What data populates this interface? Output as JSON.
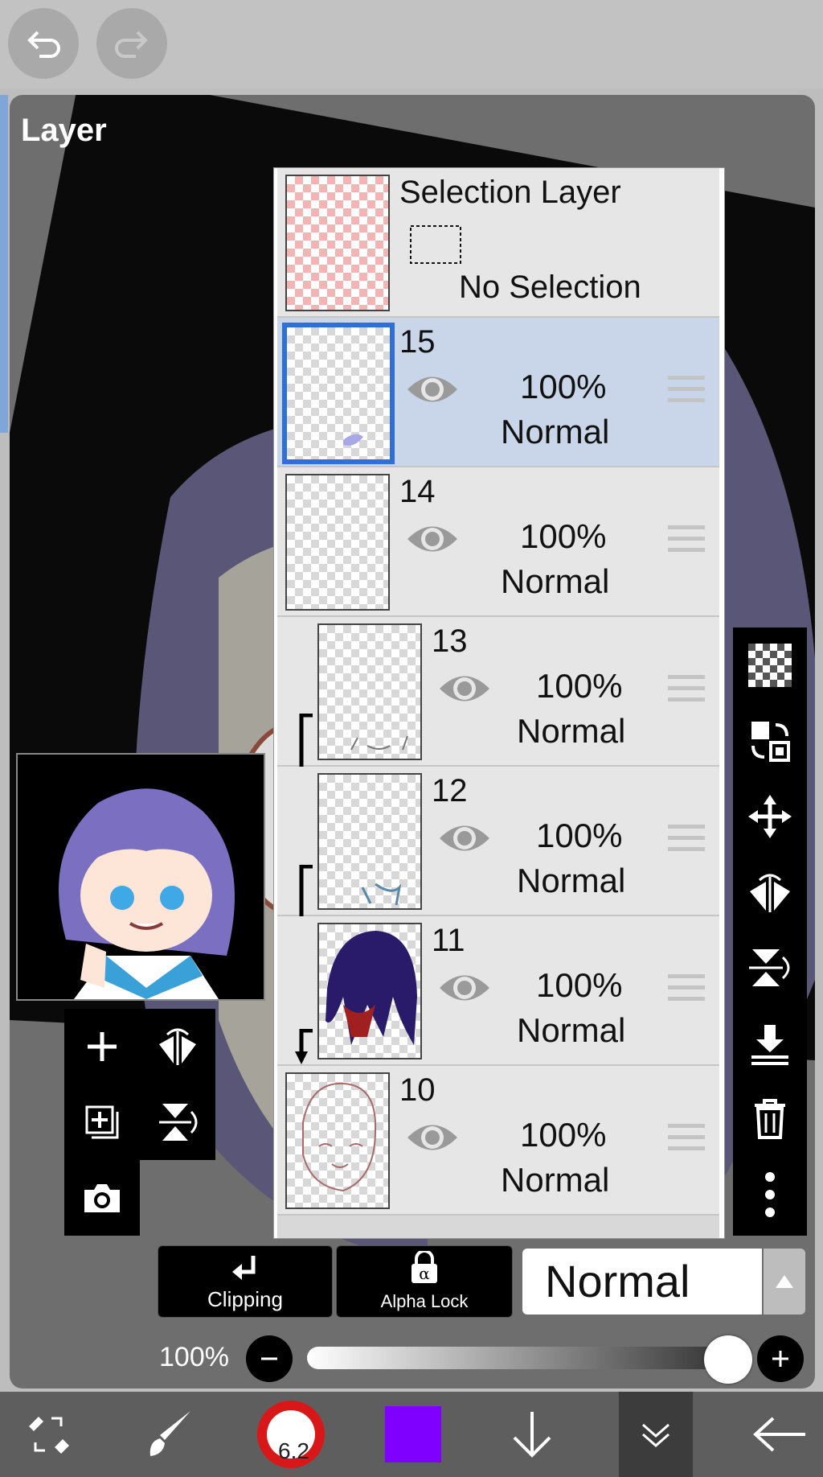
{
  "header": {
    "undo_icon": "undo-icon",
    "redo_icon": "redo-icon"
  },
  "panel": {
    "title": "Layer"
  },
  "selection_layer": {
    "title": "Selection Layer",
    "status": "No Selection"
  },
  "layers": [
    {
      "name": "15",
      "opacity": "100%",
      "mode": "Normal",
      "selected": true,
      "clipped": false
    },
    {
      "name": "14",
      "opacity": "100%",
      "mode": "Normal",
      "selected": false,
      "clipped": false
    },
    {
      "name": "13",
      "opacity": "100%",
      "mode": "Normal",
      "selected": false,
      "clipped": true
    },
    {
      "name": "12",
      "opacity": "100%",
      "mode": "Normal",
      "selected": false,
      "clipped": true
    },
    {
      "name": "11",
      "opacity": "100%",
      "mode": "Normal",
      "selected": false,
      "clipped": true
    },
    {
      "name": "10",
      "opacity": "100%",
      "mode": "Normal",
      "selected": false,
      "clipped": false
    }
  ],
  "bottom_controls": {
    "clipping_label": "Clipping",
    "alpha_lock_label": "Alpha Lock",
    "blend_mode": "Normal",
    "opacity_label": "100%",
    "opacity_value": 1.0
  },
  "toolbar": {
    "brush_size": "6.2",
    "color": "#8000ff"
  }
}
